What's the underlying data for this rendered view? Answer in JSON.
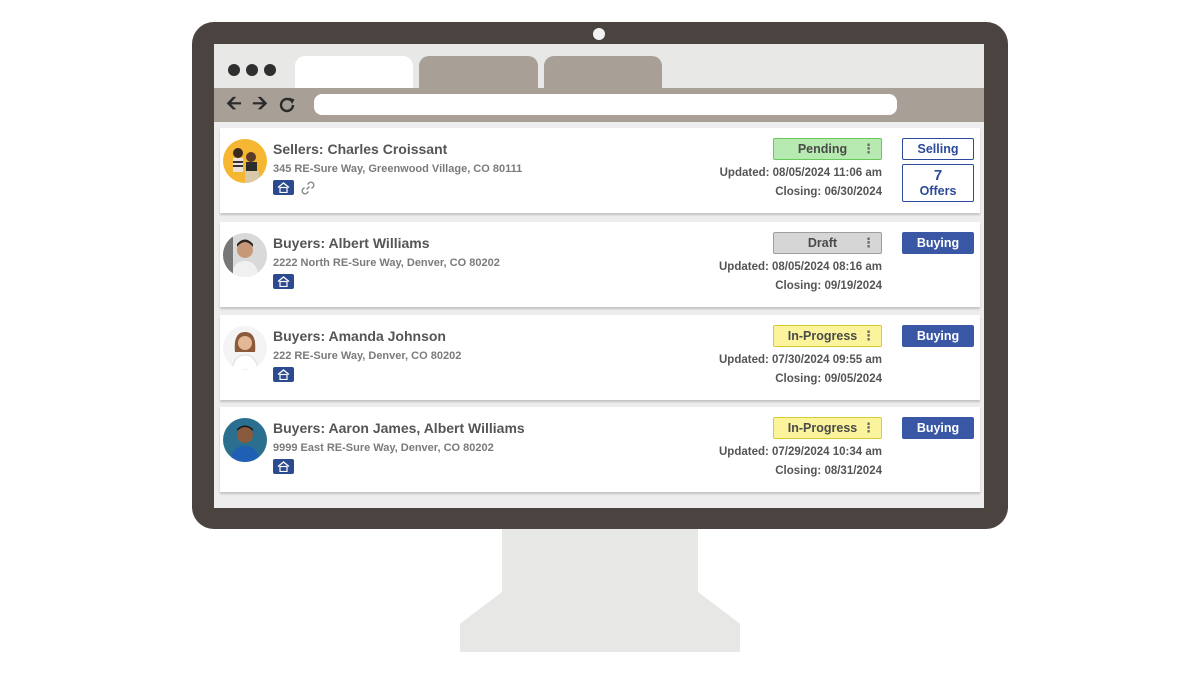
{
  "browser": {
    "url": "",
    "nav_icons": [
      "back-arrow-icon",
      "forward-arrow-icon",
      "reload-icon"
    ]
  },
  "colors": {
    "bezel": "#4b4340",
    "chrome": "#a89f96",
    "accent_blue": "#2c4a9a",
    "pending": "#b7eab0",
    "draft": "#d6d6d6",
    "in_progress": "#fbf49c"
  },
  "transactions": [
    {
      "name": "Sellers: Charles Croissant",
      "address": "345 RE-Sure Way, Greenwood Village, CO 80111",
      "status": "Pending",
      "updated": "Updated: 08/05/2024 11:06 am",
      "closing": "Closing: 06/30/2024",
      "type": "Selling",
      "offers_count": "7",
      "offers_label": "Offers",
      "icons": [
        "home-icon",
        "link-icon"
      ]
    },
    {
      "name": "Buyers: Albert Williams",
      "address": "2222 North RE-Sure Way, Denver, CO 80202",
      "status": "Draft",
      "updated": "Updated: 08/05/2024 08:16 am",
      "closing": "Closing: 09/19/2024",
      "type": "Buying",
      "icons": [
        "home-icon"
      ]
    },
    {
      "name": "Buyers: Amanda Johnson",
      "address": "222 RE-Sure Way, Denver, CO 80202",
      "status": "In-Progress",
      "updated": "Updated: 07/30/2024 09:55 am",
      "closing": "Closing: 09/05/2024",
      "type": "Buying",
      "icons": [
        "home-icon"
      ]
    },
    {
      "name": "Buyers: Aaron James, Albert Williams",
      "address": "9999 East RE-Sure Way, Denver, CO 80202",
      "status": "In-Progress",
      "updated": "Updated: 07/29/2024 10:34 am",
      "closing": "Closing: 08/31/2024",
      "type": "Buying",
      "icons": [
        "home-icon"
      ]
    }
  ]
}
